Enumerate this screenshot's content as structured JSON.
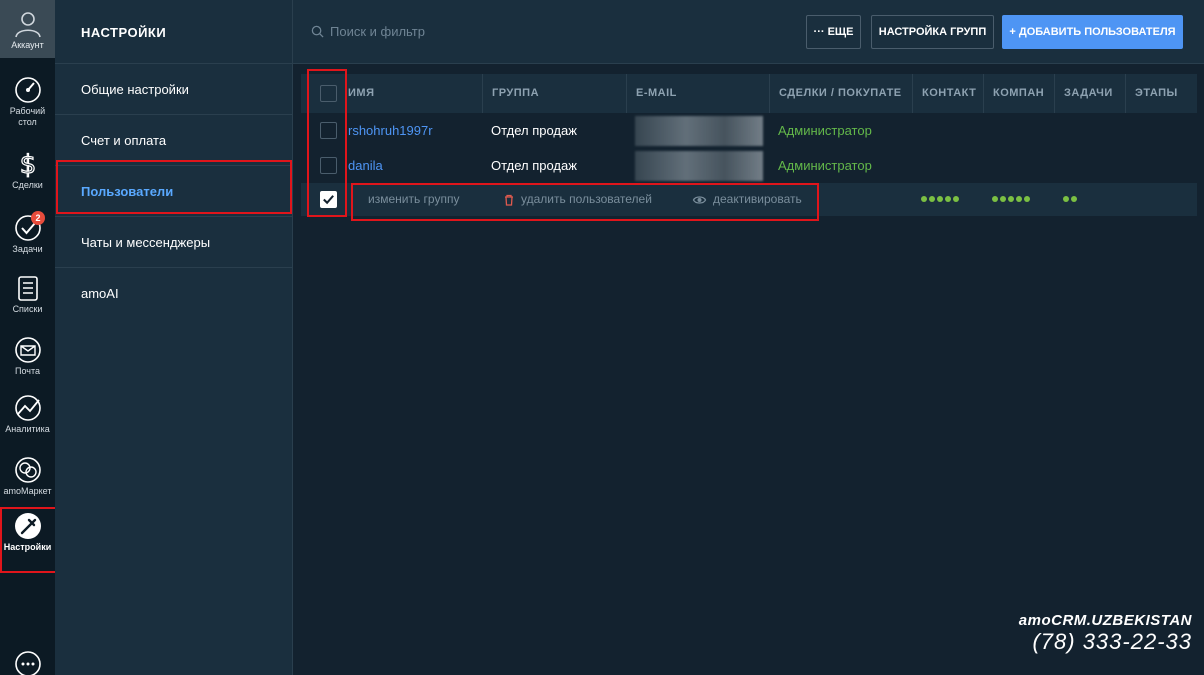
{
  "rail": {
    "account": "Аккаунт",
    "items": [
      {
        "label": "Рабочий стол",
        "icon": "dashboard-icon"
      },
      {
        "label": "Сделки",
        "icon": "dollar-icon"
      },
      {
        "label": "Задачи",
        "icon": "check-circle-icon",
        "badge": "2"
      },
      {
        "label": "Списки",
        "icon": "list-icon"
      },
      {
        "label": "Почта",
        "icon": "mail-icon"
      },
      {
        "label": "Аналитика",
        "icon": "analytics-icon"
      },
      {
        "label": "amoМаркет",
        "icon": "market-icon"
      },
      {
        "label": "Настройки",
        "icon": "settings-wrench-icon"
      }
    ],
    "chat_icon": "chat-icon"
  },
  "settings": {
    "title": "НАСТРОЙКИ",
    "items": [
      {
        "label": "Общие настройки"
      },
      {
        "label": "Счет и оплата"
      },
      {
        "label": "Пользователи"
      },
      {
        "label": "Чаты и мессенджеры"
      },
      {
        "label": "amoAI"
      }
    ]
  },
  "topbar": {
    "search_placeholder": "Поиск и фильтр",
    "more_label": "··· ЕЩЕ",
    "groups_label": "НАСТРОЙКА ГРУПП",
    "add_label": "+ ДОБАВИТЬ ПОЛЬЗОВАТЕЛЯ"
  },
  "table": {
    "columns": [
      "ИМЯ",
      "ГРУППА",
      "E-MAIL",
      "СДЕЛКИ / ПОКУПАТЕ",
      "КОНТАКТ",
      "КОМПАН",
      "ЗАДАЧИ",
      "ЭТАПЫ"
    ],
    "rows": [
      {
        "name": "rshohruh1997r",
        "group": "Отдел продаж",
        "role": "Администратор"
      },
      {
        "name": "danila",
        "group": "Отдел продаж",
        "role": "Администратор"
      }
    ],
    "actions": {
      "change_group": "изменить группу",
      "delete_users": "удалить пользователей",
      "deactivate": "деактивировать"
    },
    "dots": {
      "contacts": 5,
      "companies": 5,
      "tasks": 2
    }
  },
  "brand": {
    "line1": "amoCRM.UZBEKISTAN",
    "line2": "(78) 333-22-33"
  }
}
